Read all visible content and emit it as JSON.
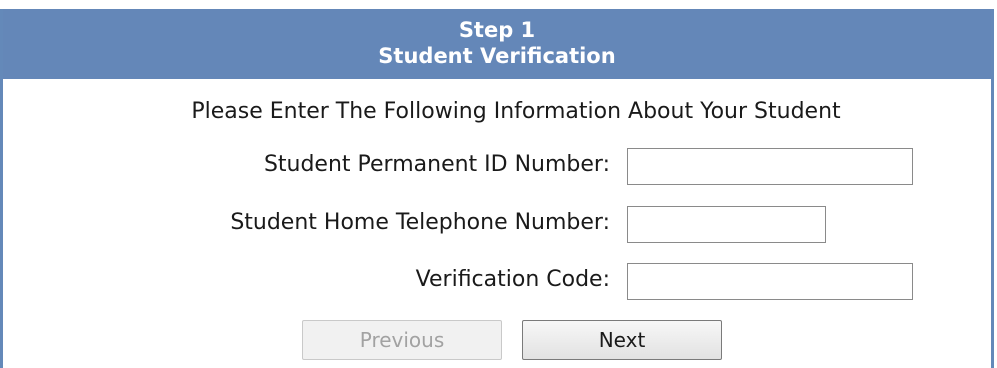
{
  "header": {
    "step": "Step 1",
    "title": "Student Verification"
  },
  "instructions": "Please Enter The Following Information About Your Student",
  "fields": {
    "permanent_id": {
      "label": "Student Permanent ID Number:",
      "value": ""
    },
    "home_phone": {
      "label": "Student Home Telephone Number:",
      "value": ""
    },
    "verification_code": {
      "label": "Verification Code:",
      "value": ""
    }
  },
  "buttons": {
    "previous": {
      "label": "Previous",
      "state": "disabled"
    },
    "next": {
      "label": "Next",
      "state": "enabled"
    }
  },
  "colors": {
    "header_background": "#6487b8",
    "header_text": "#ffffff",
    "panel_border": "#6489b9"
  }
}
